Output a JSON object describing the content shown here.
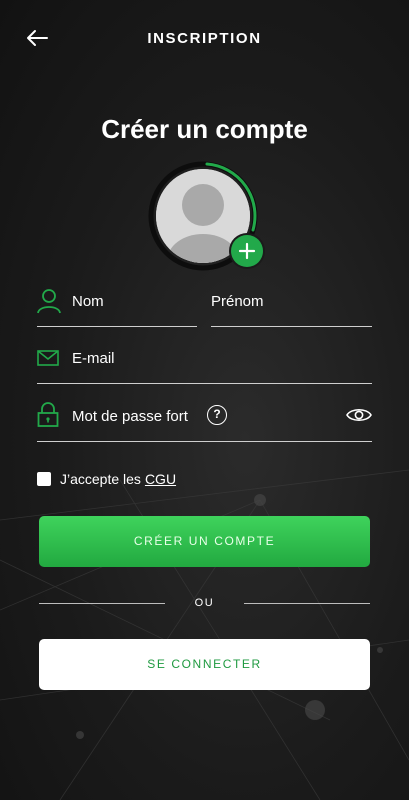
{
  "header": {
    "title": "INSCRIPTION",
    "back_icon": "arrow-left-icon"
  },
  "page_title": "Créer un compte",
  "avatar": {
    "add_icon": "plus-icon"
  },
  "form": {
    "nom": {
      "placeholder": "Nom",
      "icon": "user-icon"
    },
    "prenom": {
      "placeholder": "Prénom"
    },
    "email": {
      "placeholder": "E-mail",
      "icon": "mail-icon"
    },
    "password": {
      "placeholder": "Mot de passe fort",
      "icon": "lock-icon",
      "help_icon": "question-icon",
      "help_glyph": "?",
      "eye_icon": "eye-icon"
    },
    "cgu": {
      "text": "J’accepte les",
      "link": "CGU",
      "checked": false
    }
  },
  "buttons": {
    "create": "CRÉER UN COMPTE",
    "login": "SE CONNECTER"
  },
  "divider": "OU",
  "colors": {
    "accent": "#22a94a",
    "background": "#1b1b1b"
  }
}
